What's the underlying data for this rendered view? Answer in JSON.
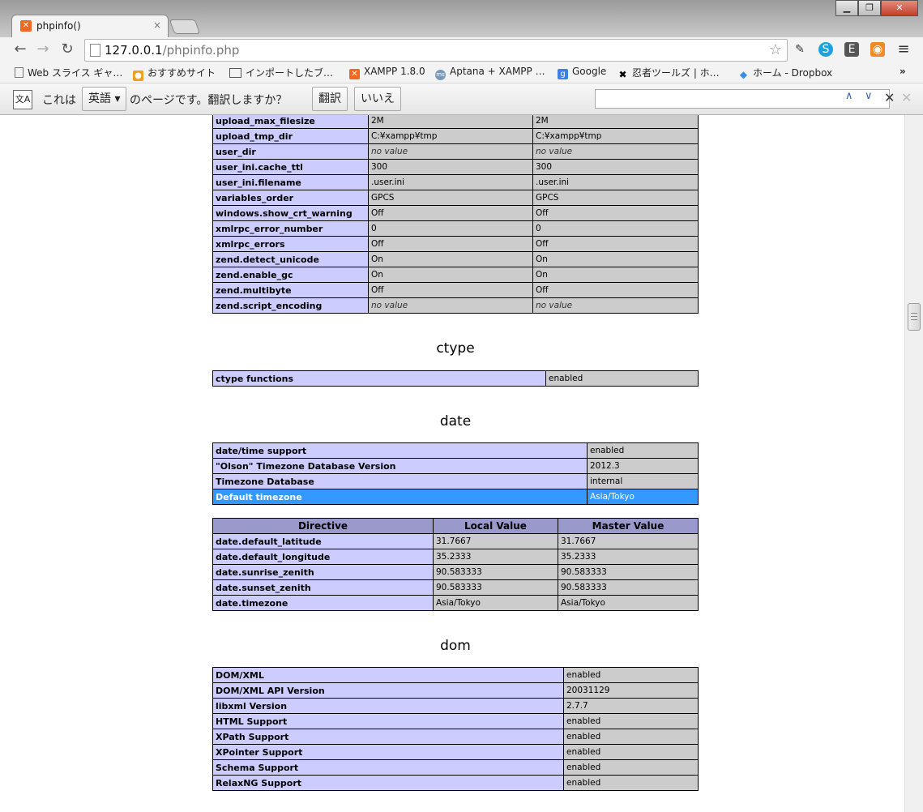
{
  "window": {
    "tab_title": "phpinfo()",
    "tab_close": "×",
    "min": "▁",
    "max": "❐",
    "close": "✕"
  },
  "toolbar": {
    "url_host": "127.0.0.1",
    "url_path": "/phpinfo.php",
    "back": "←",
    "forward": "→",
    "reload": "↻"
  },
  "bookmarks": [
    {
      "label": "Web スライス ギャ…",
      "icon": "page-icon"
    },
    {
      "label": "おすすめサイト",
      "icon": "bulb-icon"
    },
    {
      "label": "インポートしたブ…",
      "icon": "folder-icon"
    },
    {
      "label": "XAMPP 1.8.0",
      "icon": "xampp-icon"
    },
    {
      "label": "Aptana + XAMPP …",
      "icon": "ms-icon"
    },
    {
      "label": "Google",
      "icon": "google-icon"
    },
    {
      "label": "忍者ツールズ | ホ…",
      "icon": "ninja-icon"
    },
    {
      "label": "ホーム - Dropbox",
      "icon": "dropbox-icon"
    }
  ],
  "translate": {
    "prefix": "これは",
    "language": "英語",
    "suffix": "のページです。翻訳しますか？",
    "translate_btn": "翻訳",
    "no_btn": "いいえ",
    "find_value": ""
  },
  "core_rows": [
    {
      "d": "upload_max_filesize",
      "l": "2M",
      "m": "2M"
    },
    {
      "d": "upload_tmp_dir",
      "l": "C:¥xampp¥tmp",
      "m": "C:¥xampp¥tmp"
    },
    {
      "d": "user_dir",
      "l": "no value",
      "m": "no value"
    },
    {
      "d": "user_ini.cache_ttl",
      "l": "300",
      "m": "300"
    },
    {
      "d": "user_ini.filename",
      "l": ".user.ini",
      "m": ".user.ini"
    },
    {
      "d": "variables_order",
      "l": "GPCS",
      "m": "GPCS"
    },
    {
      "d": "windows.show_crt_warning",
      "l": "Off",
      "m": "Off"
    },
    {
      "d": "xmlrpc_error_number",
      "l": "0",
      "m": "0"
    },
    {
      "d": "xmlrpc_errors",
      "l": "Off",
      "m": "Off"
    },
    {
      "d": "zend.detect_unicode",
      "l": "On",
      "m": "On"
    },
    {
      "d": "zend.enable_gc",
      "l": "On",
      "m": "On"
    },
    {
      "d": "zend.multibyte",
      "l": "Off",
      "m": "Off"
    },
    {
      "d": "zend.script_encoding",
      "l": "no value",
      "m": "no value"
    }
  ],
  "ctype": {
    "heading": "ctype",
    "rows": [
      {
        "k": "ctype functions",
        "v": "enabled"
      }
    ]
  },
  "date": {
    "heading": "date",
    "info": [
      {
        "k": "date/time support",
        "v": "enabled"
      },
      {
        "k": "\"Olson\" Timezone Database Version",
        "v": "2012.3"
      },
      {
        "k": "Timezone Database",
        "v": "internal"
      },
      {
        "k": "Default timezone",
        "v": "Asia/Tokyo"
      }
    ],
    "headers": [
      "Directive",
      "Local Value",
      "Master Value"
    ],
    "directives": [
      {
        "d": "date.default_latitude",
        "l": "31.7667",
        "m": "31.7667"
      },
      {
        "d": "date.default_longitude",
        "l": "35.2333",
        "m": "35.2333"
      },
      {
        "d": "date.sunrise_zenith",
        "l": "90.583333",
        "m": "90.583333"
      },
      {
        "d": "date.sunset_zenith",
        "l": "90.583333",
        "m": "90.583333"
      },
      {
        "d": "date.timezone",
        "l": "Asia/Tokyo",
        "m": "Asia/Tokyo"
      }
    ]
  },
  "dom": {
    "heading": "dom",
    "rows": [
      {
        "k": "DOM/XML",
        "v": "enabled"
      },
      {
        "k": "DOM/XML API Version",
        "v": "20031129"
      },
      {
        "k": "libxml Version",
        "v": "2.7.7"
      },
      {
        "k": "HTML Support",
        "v": "enabled"
      },
      {
        "k": "XPath Support",
        "v": "enabled"
      },
      {
        "k": "XPointer Support",
        "v": "enabled"
      },
      {
        "k": "Schema Support",
        "v": "enabled"
      },
      {
        "k": "RelaxNG Support",
        "v": "enabled"
      }
    ]
  },
  "colors": {
    "header_bg": "#9999cc",
    "key_bg": "#ccccff",
    "value_bg": "#cccccc",
    "selection": "#3399ff"
  }
}
